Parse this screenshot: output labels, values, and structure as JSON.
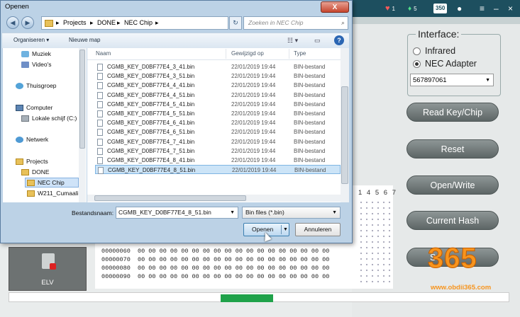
{
  "app": {
    "titlebar": {
      "badge_red": "1",
      "badge_green": "5",
      "badge_count": "350"
    },
    "interface": {
      "title": "Interface:",
      "options": [
        "Infrared",
        "NEC Adapter"
      ],
      "selected": "NEC Adapter",
      "adapter_serial": "567897061"
    },
    "buttons": [
      "Read Key/Chip",
      "Reset",
      "Open/Write",
      "Current Hash",
      "S"
    ],
    "hex": {
      "column_header": "1 4 5 6 7",
      "rows": [
        "00000060  00 00 00 00 00 00 00 00 00 00 00 00 00 00 00 00 00 00",
        "00000070  00 00 00 00 00 00 00 00 00 00 00 00 00 00 00 00 00 00",
        "00000080  00 00 00 00 00 00 00 00 00 00 00 00 00 00 00 00 00 00",
        "00000090  00 00 00 00 00 00 00 00 00 00 00 00 00 00 00 00 00 00"
      ]
    },
    "elv_label": "ELV",
    "watermark": {
      "digits": "365",
      "url": "www.obdii365.com"
    }
  },
  "dialog": {
    "title": "Openen",
    "close_label": "X",
    "breadcrumb": [
      "Projects",
      "DONE",
      "NEC Chip"
    ],
    "search_placeholder": "Zoeken in NEC Chip",
    "commands": {
      "organize": "Organiseren ▾",
      "new_folder": "Nieuwe map"
    },
    "nav": [
      {
        "label": "Muziek",
        "icon": "music-icon"
      },
      {
        "label": "Video's",
        "icon": "video-icon"
      },
      {
        "label": "Thuisgroep",
        "icon": "homegroup-icon"
      },
      {
        "label": "Computer",
        "icon": "computer-icon"
      },
      {
        "label": "Lokale schijf (C:)",
        "icon": "disk-icon"
      },
      {
        "label": "Netwerk",
        "icon": "network-icon"
      },
      {
        "label": "Projects",
        "icon": "folder-icon"
      },
      {
        "label": "DONE",
        "icon": "folder-icon"
      },
      {
        "label": "NEC Chip",
        "icon": "folder-icon"
      },
      {
        "label": "W211_Cumaali",
        "icon": "folder-icon"
      }
    ],
    "columns": {
      "name": "Naam",
      "modified": "Gewijzigd op",
      "type": "Type"
    },
    "files": [
      {
        "name": "CGMB_KEY_D0BF77E4_3_41.bin",
        "date": "22/01/2019 19:44",
        "type": "BIN-bestand"
      },
      {
        "name": "CGMB_KEY_D0BF77E4_3_51.bin",
        "date": "22/01/2019 19:44",
        "type": "BIN-bestand"
      },
      {
        "name": "CGMB_KEY_D0BF77E4_4_41.bin",
        "date": "22/01/2019 19:44",
        "type": "BIN-bestand"
      },
      {
        "name": "CGMB_KEY_D0BF77E4_4_51.bin",
        "date": "22/01/2019 19:44",
        "type": "BIN-bestand"
      },
      {
        "name": "CGMB_KEY_D0BF77E4_5_41.bin",
        "date": "22/01/2019 19:44",
        "type": "BIN-bestand"
      },
      {
        "name": "CGMB_KEY_D0BF77E4_5_51.bin",
        "date": "22/01/2019 19:44",
        "type": "BIN-bestand"
      },
      {
        "name": "CGMB_KEY_D0BF77E4_6_41.bin",
        "date": "22/01/2019 19:44",
        "type": "BIN-bestand"
      },
      {
        "name": "CGMB_KEY_D0BF77E4_6_51.bin",
        "date": "22/01/2019 19:44",
        "type": "BIN-bestand"
      },
      {
        "name": "CGMB_KEY_D0BF77E4_7_41.bin",
        "date": "22/01/2019 19:44",
        "type": "BIN-bestand"
      },
      {
        "name": "CGMB_KEY_D0BF77E4_7_51.bin",
        "date": "22/01/2019 19:44",
        "type": "BIN-bestand"
      },
      {
        "name": "CGMB_KEY_D0BF77E4_8_41.bin",
        "date": "22/01/2019 19:44",
        "type": "BIN-bestand"
      },
      {
        "name": "CGMB_KEY_D0BF77E4_8_51.bin",
        "date": "22/01/2019 19:44",
        "type": "BIN-bestand"
      }
    ],
    "selected_file_index": 11,
    "filename_label": "Bestandsnaam:",
    "filename_value": "CGMB_KEY_D0BF77E4_8_51.bin",
    "filter_value": "Bin files (*.bin)",
    "open_label": "Openen",
    "cancel_label": "Annuleren"
  },
  "colors": {
    "app_titlebar": "#1d4f5f",
    "progress": "#1fa24a",
    "watermark": "#f7941d",
    "selection": "#cce4f7"
  }
}
